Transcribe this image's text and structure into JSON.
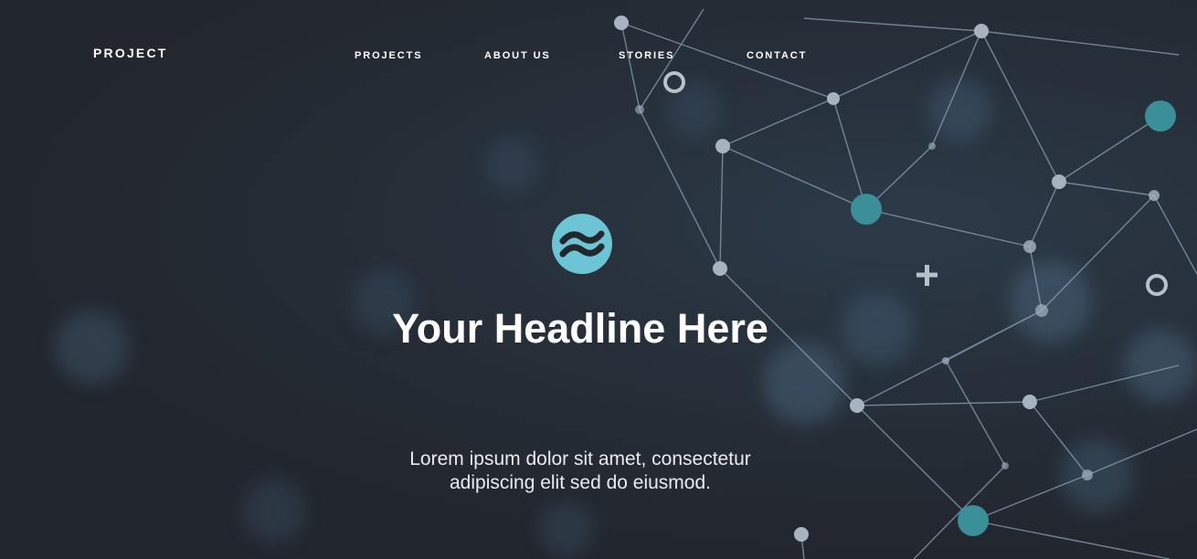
{
  "brand": {
    "name": "PROJECT"
  },
  "nav": {
    "items": [
      {
        "label": "PROJECTS"
      },
      {
        "label": "ABOUT US"
      },
      {
        "label": "STORIES"
      },
      {
        "label": "CONTACT"
      }
    ]
  },
  "hero": {
    "logo_icon": "wave-circle-icon",
    "headline": "Your Headline Here",
    "subtext": "Lorem ipsum dolor sit amet, consectetur adipiscing elit sed do eiusmod."
  },
  "colors": {
    "background": "#23272e",
    "accent": "#6cc4d4",
    "text": "#ffffff"
  }
}
